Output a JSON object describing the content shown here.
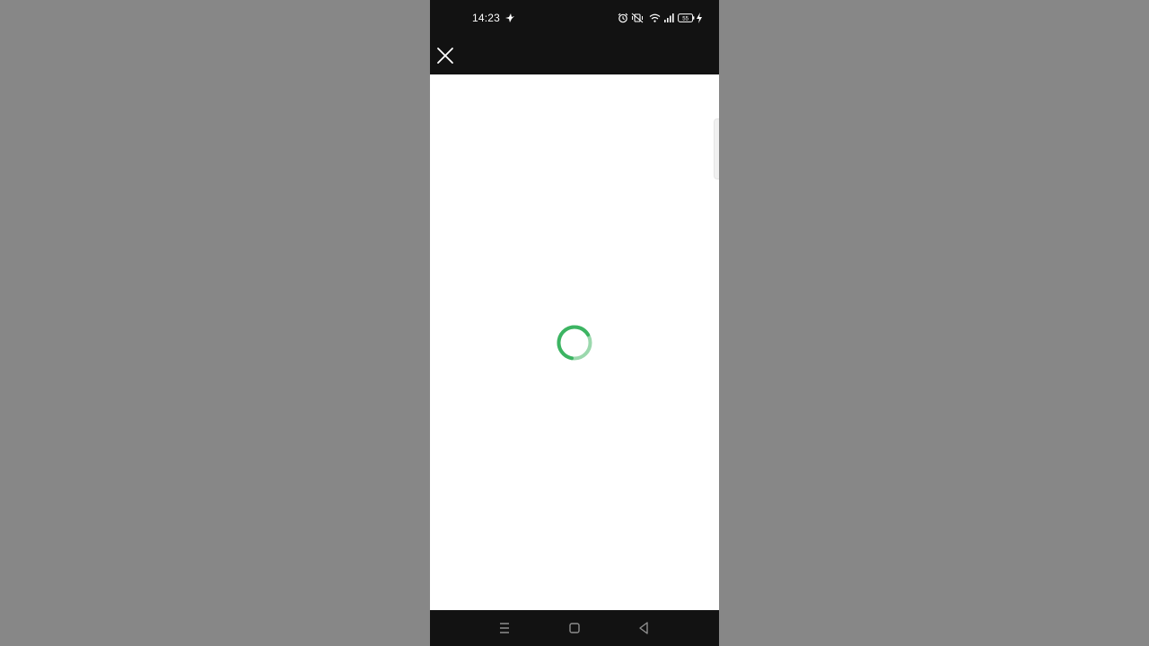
{
  "status_bar": {
    "time": "14:23",
    "icons": [
      "bird-notification-icon",
      "alarm-icon",
      "vibrate-mute-icon",
      "wifi-icon",
      "signal-icon",
      "battery-icon",
      "charging-icon"
    ],
    "battery_level": "55"
  },
  "top_bar": {
    "close_icon": "close-icon"
  },
  "content": {
    "loading_spinner_color": "#3cb462",
    "loading_spinner_track_color": "#9bd8ad"
  },
  "nav_bar": {
    "buttons": [
      "menu-icon",
      "home-icon",
      "back-icon"
    ]
  },
  "colors": {
    "background": "#878787",
    "bars": "#121212",
    "content": "#ffffff"
  }
}
